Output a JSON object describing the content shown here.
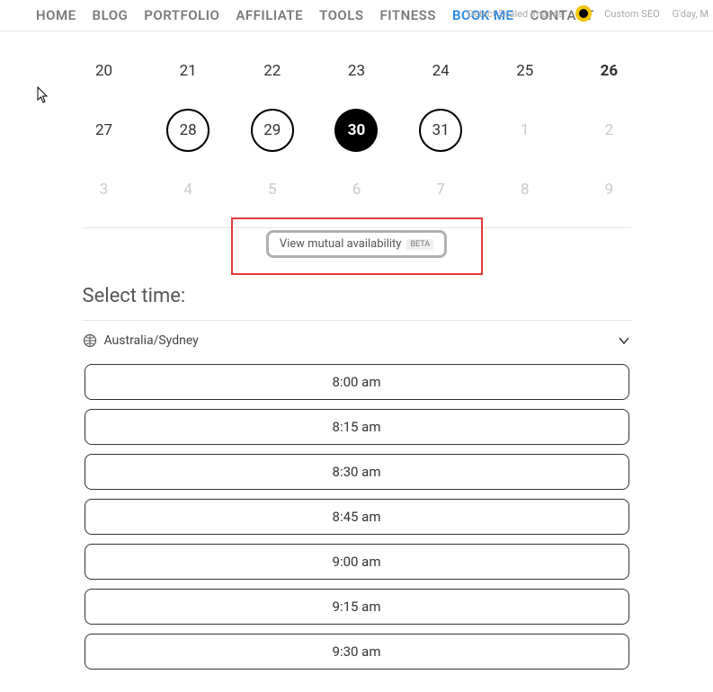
{
  "nav": {
    "items": [
      "HOME",
      "BLOG",
      "PORTFOLIO",
      "AFFILIATE",
      "TOOLS",
      "FITNESS",
      "BOOK ME",
      "CONTACT"
    ],
    "active_index": 6,
    "right_text1": "Detect Scaled Images",
    "right_text2": "Custom SEO",
    "right_text3": "G'day, M"
  },
  "calendar": {
    "rows": [
      [
        {
          "n": "20",
          "dim": false
        },
        {
          "n": "21",
          "dim": false
        },
        {
          "n": "22",
          "dim": false
        },
        {
          "n": "23",
          "dim": false
        },
        {
          "n": "24",
          "dim": false
        },
        {
          "n": "25",
          "dim": false
        },
        {
          "n": "26",
          "dim": false,
          "bold": true
        }
      ],
      [
        {
          "n": "27",
          "dim": false
        },
        {
          "n": "28",
          "dim": false,
          "ring": true
        },
        {
          "n": "29",
          "dim": false,
          "ring": true
        },
        {
          "n": "30",
          "dim": false,
          "sel": true
        },
        {
          "n": "31",
          "dim": false,
          "ring": true
        },
        {
          "n": "1",
          "dim": true
        },
        {
          "n": "2",
          "dim": true
        }
      ],
      [
        {
          "n": "3",
          "dim": true
        },
        {
          "n": "4",
          "dim": true
        },
        {
          "n": "5",
          "dim": true
        },
        {
          "n": "6",
          "dim": true
        },
        {
          "n": "7",
          "dim": true
        },
        {
          "n": "8",
          "dim": true
        },
        {
          "n": "9",
          "dim": true
        }
      ]
    ]
  },
  "mutual": {
    "label": "View mutual availability",
    "badge": "BETA"
  },
  "select_time": {
    "heading": "Select time:",
    "timezone": "Australia/Sydney",
    "slots": [
      "8:00 am",
      "8:15 am",
      "8:30 am",
      "8:45 am",
      "9:00 am",
      "9:15 am",
      "9:30 am"
    ]
  }
}
